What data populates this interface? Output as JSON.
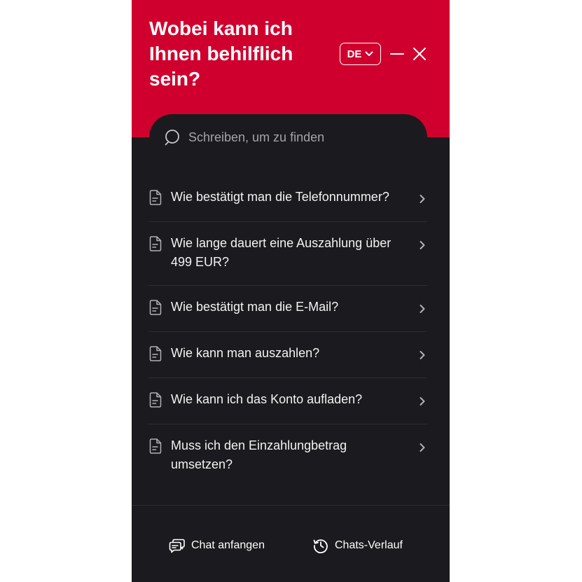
{
  "header": {
    "title_line1": "Wobei kann ich",
    "title_line2": "Ihnen behilflich",
    "title_line3": "sein?",
    "language": "DE",
    "icons": {
      "minimize": "minimize-icon",
      "close": "close-icon",
      "language_dropdown": "chevron-down-icon"
    }
  },
  "search": {
    "placeholder": "Schreiben, um zu finden",
    "value": "",
    "icon": "search-icon"
  },
  "faq": {
    "items": [
      {
        "label": "Wie bestätigt man die Telefonnummer?"
      },
      {
        "label": "Wie lange dauert eine Auszahlung über 499 EUR?"
      },
      {
        "label": "Wie bestätigt man die E-Mail?"
      },
      {
        "label": "Wie kann man auszahlen?"
      },
      {
        "label": "Wie kann ich das Konto aufladen?"
      },
      {
        "label": "Muss ich den Einzahlungbetrag umsetzen?"
      }
    ],
    "item_icon": "document-icon",
    "arrow_icon": "chevron-right-icon"
  },
  "footer": {
    "chat_label": "Chat anfangen",
    "history_label": "Chats-Verlauf",
    "icons": {
      "chat": "chat-bubbles-icon",
      "history": "history-icon"
    }
  },
  "colors": {
    "brand_red": "#d0002e",
    "panel_bg": "#1b1b1f",
    "text": "#ffffff",
    "muted": "#a3a3a8"
  }
}
